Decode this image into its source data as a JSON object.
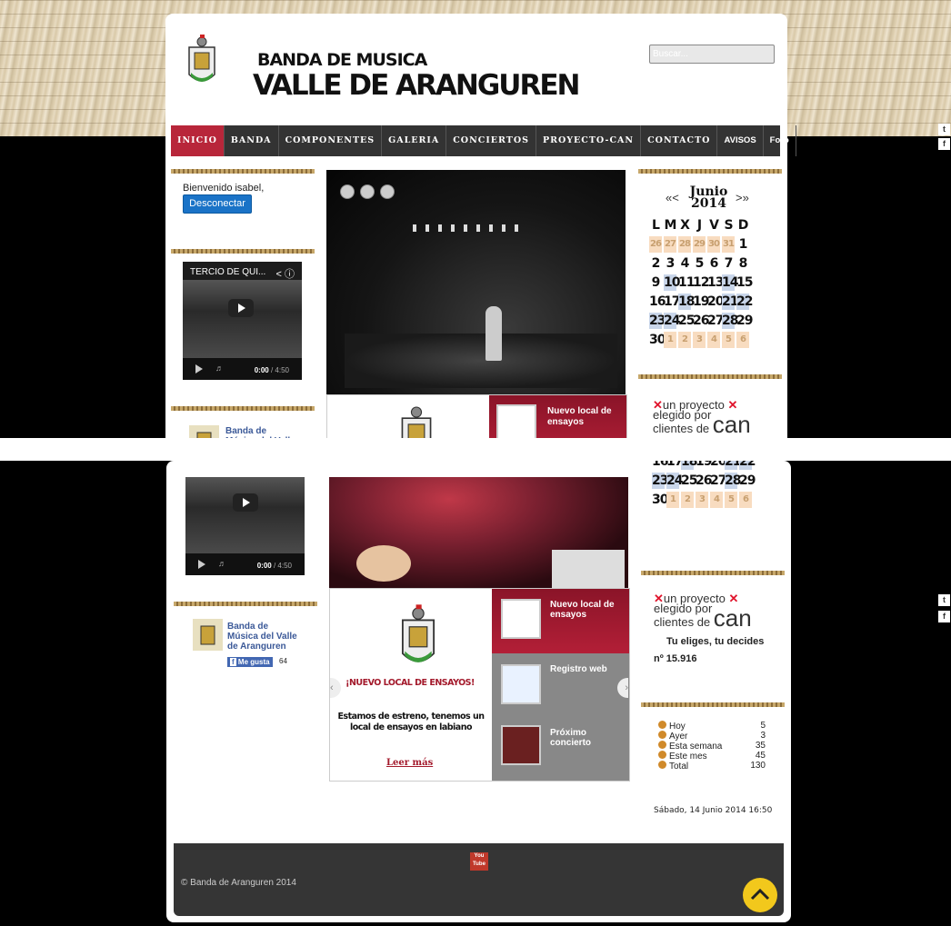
{
  "site": {
    "title_line1": "BANDA DE MUSICA",
    "title_line2": "VALLE DE ARANGUREN",
    "search_placeholder": "Buscar..."
  },
  "nav": [
    "INICIO",
    "BANDA",
    "COMPONENTES",
    "GALERIA",
    "CONCIERTOS",
    "PROYECTO-CAN",
    "CONTACTO",
    "AVISOS",
    "Foro"
  ],
  "login": {
    "welcome": "Bienvenido isabel,",
    "logout_label": "Desconectar"
  },
  "video": {
    "title": "TERCIO DE QUI...",
    "time_current": "0:00",
    "time_total": " / 4:50"
  },
  "facebook": {
    "page_name": "Banda de Música del Valle de Aranguren",
    "like_label": "Me gusta",
    "like_count": "64"
  },
  "calendar": {
    "prev": "«<",
    "next": ">»",
    "month": "Junio",
    "year": "2014",
    "weekdays": [
      "L",
      "M",
      "X",
      "J",
      "V",
      "S",
      "D"
    ],
    "weeks": [
      [
        [
          "26",
          "o"
        ],
        [
          "27",
          "o"
        ],
        [
          "28",
          "o"
        ],
        [
          "29",
          "o"
        ],
        [
          "30",
          "o"
        ],
        [
          "31",
          "o"
        ],
        [
          "1",
          ""
        ]
      ],
      [
        [
          "2",
          ""
        ],
        [
          "3",
          ""
        ],
        [
          "4",
          ""
        ],
        [
          "5",
          ""
        ],
        [
          "6",
          ""
        ],
        [
          "7",
          ""
        ],
        [
          "8",
          ""
        ]
      ],
      [
        [
          "9",
          ""
        ],
        [
          "10",
          "b"
        ],
        [
          "11",
          ""
        ],
        [
          "12",
          ""
        ],
        [
          "13",
          ""
        ],
        [
          "14",
          "b"
        ],
        [
          "15",
          ""
        ]
      ],
      [
        [
          "16",
          ""
        ],
        [
          "17",
          ""
        ],
        [
          "18",
          "b"
        ],
        [
          "19",
          ""
        ],
        [
          "20",
          ""
        ],
        [
          "21",
          "b"
        ],
        [
          "22",
          "b"
        ]
      ],
      [
        [
          "23",
          "b"
        ],
        [
          "24",
          "b"
        ],
        [
          "25",
          ""
        ],
        [
          "26",
          ""
        ],
        [
          "27",
          ""
        ],
        [
          "28",
          "b"
        ],
        [
          "29",
          ""
        ]
      ],
      [
        [
          "30",
          ""
        ],
        [
          "1",
          "o"
        ],
        [
          "2",
          "o"
        ],
        [
          "3",
          "o"
        ],
        [
          "4",
          "o"
        ],
        [
          "5",
          "o"
        ],
        [
          "6",
          "o"
        ]
      ]
    ]
  },
  "can": {
    "tagline1": "un proyecto",
    "tagline2": "elegido por",
    "tagline3": "clientes de",
    "brand": "can",
    "slogan": "Tu eliges, tu decides",
    "number": "nº 15.916"
  },
  "slider": {
    "tabs": [
      {
        "label": "Nuevo local de ensayos"
      },
      {
        "label": "Registro web"
      },
      {
        "label": "Próximo concierto"
      }
    ],
    "headline": "¡NUEVO LOCAL DE ENSAYOS!",
    "text": "Estamos de estreno, tenemos un local de ensayos en labiano",
    "read_more": "Leer más"
  },
  "stats": [
    {
      "label": "Hoy",
      "value": "5"
    },
    {
      "label": "Ayer",
      "value": "3"
    },
    {
      "label": "Esta semana",
      "value": "35"
    },
    {
      "label": "Este mes",
      "value": "45"
    },
    {
      "label": "Total",
      "value": "130"
    }
  ],
  "datetime": "Sábado, 14 Junio 2014 16:50",
  "footer": {
    "copyright": "© Banda de Aranguren 2014",
    "youtube_label": "You Tube"
  },
  "social": {
    "tumblr": "t",
    "facebook": "f"
  },
  "colors": {
    "accent_red": "#b8263a",
    "nav_bg": "#333333",
    "scrolltop_yellow": "#f2c81c"
  }
}
